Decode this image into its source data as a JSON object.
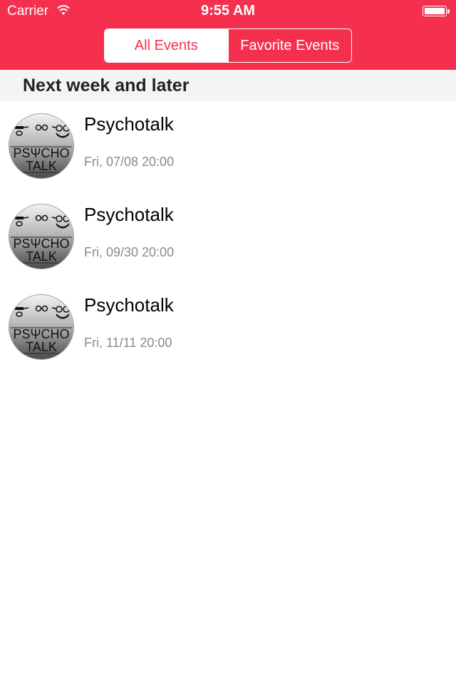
{
  "status_bar": {
    "carrier": "Carrier",
    "time": "9:55 AM",
    "wifi_icon": "wifi-icon",
    "battery_icon": "battery-icon"
  },
  "segmented": {
    "all_events": "All Events",
    "favorite_events": "Favorite Events",
    "selected": "All Events"
  },
  "section": {
    "title": "Next week and later"
  },
  "events": [
    {
      "title": "Psychotalk",
      "date": "Fri, 07/08 20:00",
      "logo_line1": "PSΨCHO",
      "logo_line2": "TALK"
    },
    {
      "title": "Psychotalk",
      "date": "Fri, 09/30 20:00",
      "logo_line1": "PSΨCHO",
      "logo_line2": "TALK"
    },
    {
      "title": "Psychotalk",
      "date": "Fri, 11/11 20:00",
      "logo_line1": "PSΨCHO",
      "logo_line2": "TALK"
    }
  ],
  "colors": {
    "accent": "#f5304e",
    "section_bg": "#f4f4f4",
    "date_text": "#8a8a8a"
  }
}
